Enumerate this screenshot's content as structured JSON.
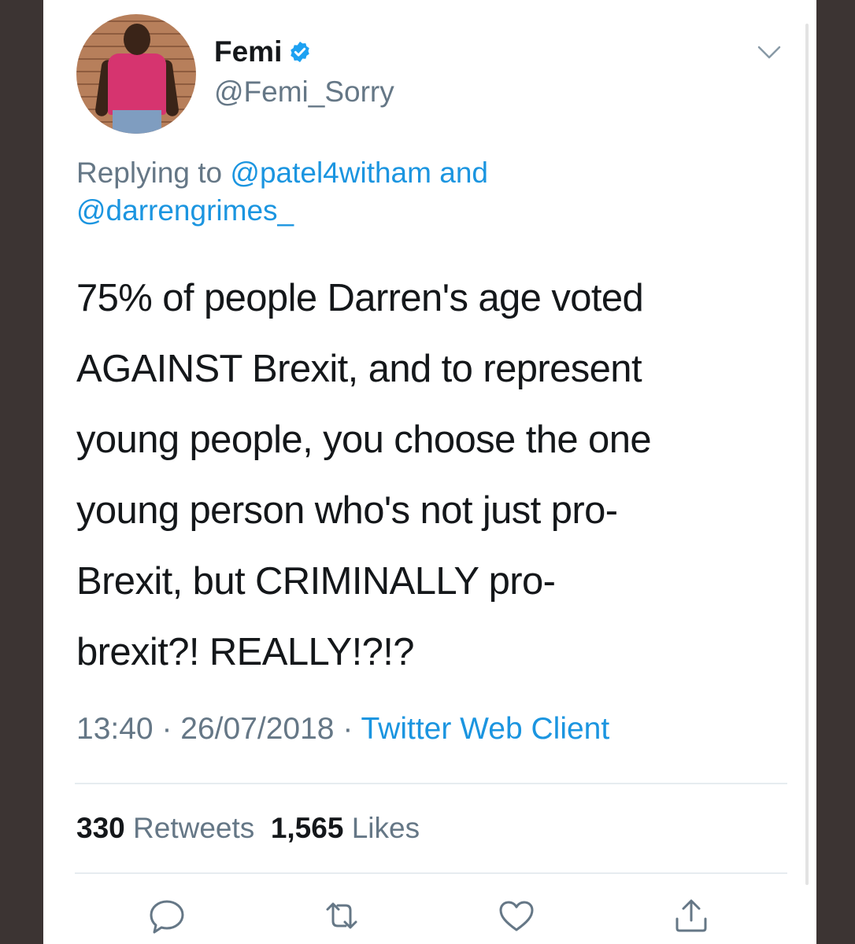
{
  "author": {
    "name": "Femi",
    "handle": "@Femi_Sorry",
    "verified": true
  },
  "reply": {
    "prefix": "Replying to",
    "mention1": "@patel4witham",
    "conjunction": "and",
    "mention2": "@darrengrimes_"
  },
  "tweet": {
    "text": "75% of people Darren's age voted\nAGAINST Brexit, and to represent\nyoung people, you choose the one\nyoung person who's not just pro-\nBrexit, but CRIMINALLY pro-\nbrexit?! REALLY!?!?"
  },
  "meta": {
    "time": "13:40",
    "separator1": "·",
    "date": "26/07/2018",
    "separator2": "·",
    "source": "Twitter Web Client"
  },
  "stats": {
    "retweets_count": "330",
    "retweets_label": "Retweets",
    "likes_count": "1,565",
    "likes_label": "Likes"
  },
  "icons": {
    "verified": "verified-badge-icon",
    "menu": "chevron-down-icon",
    "reply": "reply-icon",
    "retweet": "retweet-icon",
    "like": "heart-icon",
    "share": "share-icon"
  },
  "colors": {
    "link": "#1b95e0",
    "secondary_text": "#657786",
    "primary_text": "#14171a",
    "background_frame": "#3c3433"
  }
}
